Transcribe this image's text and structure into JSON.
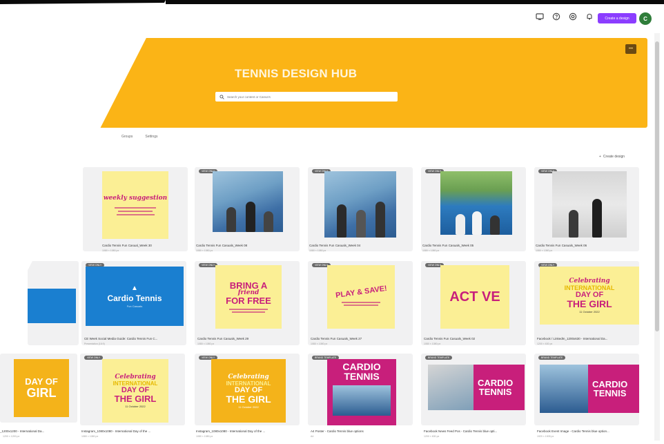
{
  "header": {
    "create_button": "Create a design",
    "avatar": "C",
    "icons": [
      "monitor-icon",
      "help-icon",
      "settings-icon",
      "notification-icon"
    ]
  },
  "hero": {
    "title": "TENNIS DESIGN HUB",
    "search_placeholder": "Search your content or Canva's",
    "menu_label": "•••",
    "color": "#fbb416"
  },
  "tabs": [
    "Groups",
    "Settings"
  ],
  "create_design": {
    "icon": "+",
    "label": "Create design"
  },
  "row1": [
    {
      "title": "Cardio Tennis Fun Casual_Week 30",
      "sub": "1080 × 1080 px",
      "thumb_text": "weekly suggestion"
    },
    {
      "badge": "VIEW ONLY",
      "title": "Cardio Tennis Fun Casuals_Week 08",
      "sub": "1080 × 1080 px"
    },
    {
      "badge": "VIEW ONLY",
      "title": "Cardio Tennis Fun Casuals_Week 04",
      "sub": "1080 × 1080 px"
    },
    {
      "badge": "VIEW ONLY",
      "title": "Cardio Tennis Fun Casuals_Week 05",
      "sub": "1080 × 1080 px"
    },
    {
      "badge": "VIEW ONLY",
      "title": "Cardio Tennis Fun Casuals_Week 06",
      "sub": "1080 × 1080 px"
    }
  ],
  "row2": [
    {
      "badge": "VIEW ONLY",
      "title": "CE Week Social Media Guide: Cardio Tennis Fun C...",
      "sub": "Presentation (16:9)",
      "thumb_text": "Cardio Tennis",
      "thumb_sub": "Fun Casuals"
    },
    {
      "badge": "VIEW ONLY",
      "title": "Cardio Tennis Fun Casuals_Week 29",
      "sub": "1080 × 1080 px",
      "line1": "BRING A",
      "line2": "friend",
      "line3": "FOR FREE"
    },
    {
      "badge": "VIEW ONLY",
      "title": "Cardio Tennis Fun Casuals_Week 27",
      "sub": "1080 × 1080 px",
      "line1": "PLAY & SAVE!"
    },
    {
      "badge": "VIEW ONLY",
      "title": "Cardio Tennis Fun Casuals_Week 02",
      "sub": "1080 × 1080 px",
      "line1": "ACT VE"
    },
    {
      "badge": "VIEW ONLY",
      "title": "Facebook / LinkedIn_1200x630 - International Da...",
      "sub": "1200 × 630 px",
      "line1": "Celebrating",
      "line2": "INTERNATIONAL",
      "line3": "DAY OF",
      "line4": "THE GIRL",
      "line5": "11 October 2022"
    }
  ],
  "row3": [
    {
      "title": "_1200x1200 - International Da...",
      "sub": "1200 × 1200 px",
      "line1": "DAY OF",
      "line2": "GIRL"
    },
    {
      "badge": "VIEW ONLY",
      "title": "Instagram_1080x1080 - International Day of the ...",
      "sub": "1080 × 1080 px",
      "line1": "Celebrating",
      "line2": "INTERNATIONAL",
      "line3": "DAY OF",
      "line4": "THE GIRL",
      "line5": "11 October 2022"
    },
    {
      "badge": "VIEW ONLY",
      "title": "Instagram_1080x1080 - International Day of the ...",
      "sub": "1080 × 1080 px",
      "line1": "Celebrating",
      "line2": "INTERNATIONAL",
      "line3": "DAY OF",
      "line4": "THE GIRL",
      "line5": "11 October 2022"
    },
    {
      "badge": "BRAND TEMPLATE",
      "title": "A4 Poster - Cardio Tennis blue options",
      "sub": "A4",
      "line1": "CARDIO",
      "line2": "TENNIS"
    },
    {
      "badge": "BRAND TEMPLATE",
      "title": "Facebook News Feed Pos - Cardio Tennis blue opti...",
      "sub": "1200 × 630 px",
      "line1": "CARDIO",
      "line2": "TENNIS"
    },
    {
      "badge": "BRAND TEMPLATE",
      "title": "Facebook Event Image - Cardio Tennis blue option...",
      "sub": "1920 × 1005 px",
      "line1": "CARDIO",
      "line2": "TENNIS"
    }
  ]
}
